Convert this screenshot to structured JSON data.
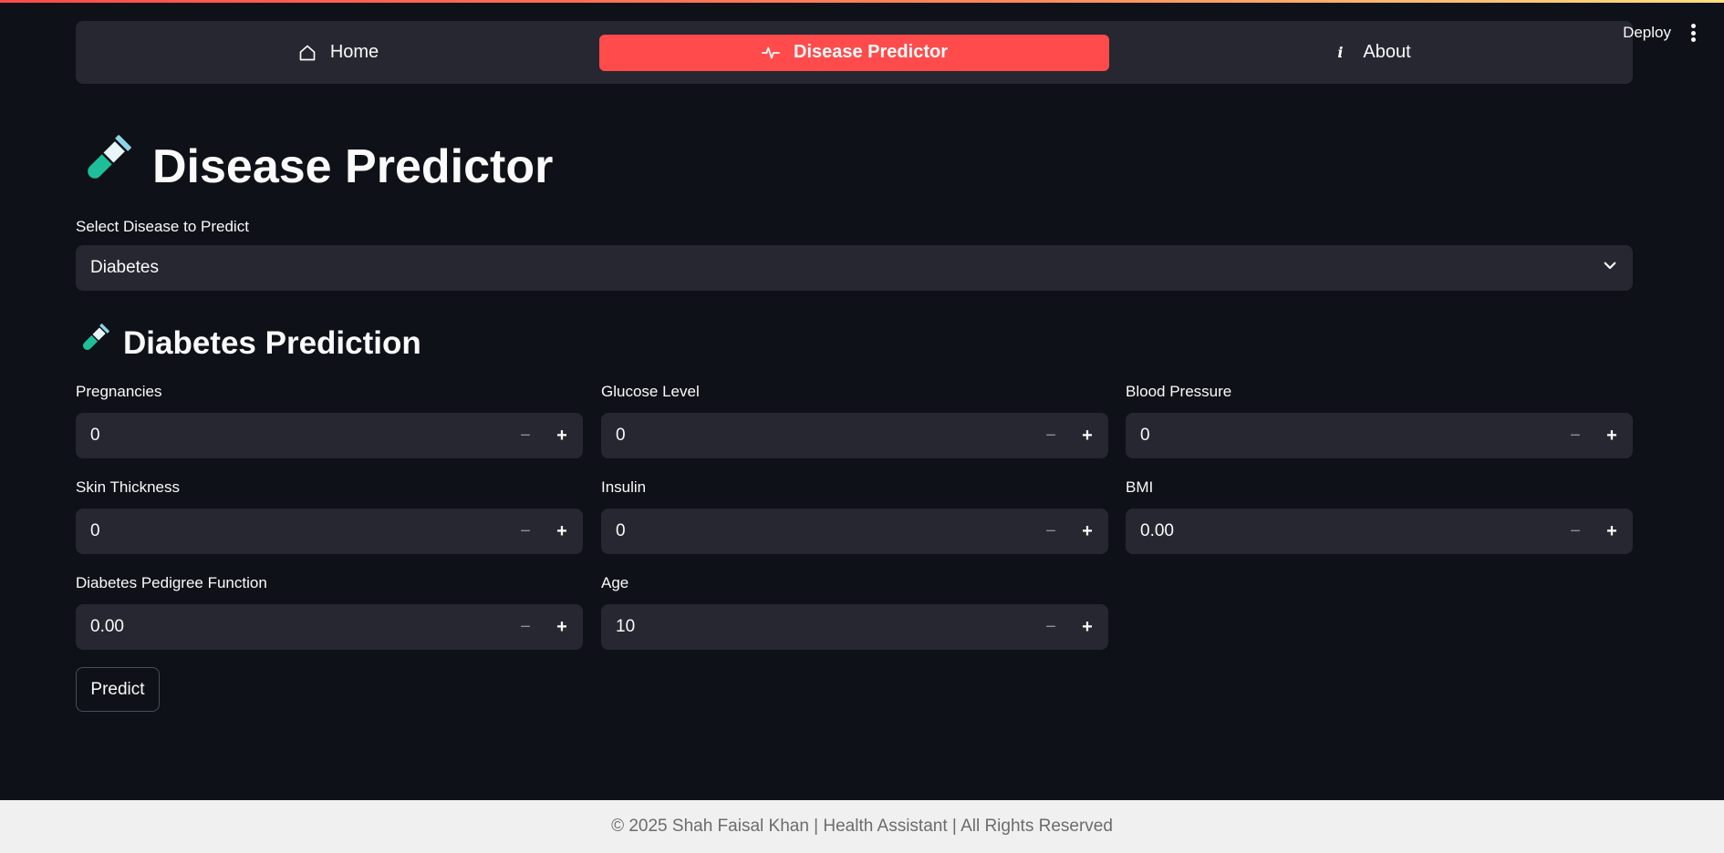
{
  "header": {
    "deploy_label": "Deploy",
    "menu_icon": "more-vertical-icon"
  },
  "nav": {
    "items": [
      {
        "label": "Home",
        "icon": "home-icon",
        "active": false
      },
      {
        "label": "Disease Predictor",
        "icon": "activity-icon",
        "active": true
      },
      {
        "label": "About",
        "icon": "info-icon",
        "active": false
      }
    ],
    "active_color": "#ff4b4b"
  },
  "page": {
    "title": "Disease Predictor",
    "title_icon": "test-tube-icon"
  },
  "disease_select": {
    "label": "Select Disease to Predict",
    "selected": "Diabetes"
  },
  "section": {
    "title": "Diabetes Prediction",
    "icon": "test-tube-icon"
  },
  "fields": [
    {
      "label": "Pregnancies",
      "value": "0"
    },
    {
      "label": "Glucose Level",
      "value": "0"
    },
    {
      "label": "Blood Pressure",
      "value": "0"
    },
    {
      "label": "Skin Thickness",
      "value": "0"
    },
    {
      "label": "Insulin",
      "value": "0"
    },
    {
      "label": "BMI",
      "value": "0.00"
    },
    {
      "label": "Diabetes Pedigree Function",
      "value": "0.00"
    },
    {
      "label": "Age",
      "value": "10"
    }
  ],
  "predict_label": "Predict",
  "footer": {
    "text": "© 2025 Shah Faisal Khan | Health Assistant | All Rights Reserved"
  },
  "colors": {
    "background": "#0e1117",
    "surface": "#262730",
    "accent": "#ff4b4b",
    "footer_bg": "#f0f0f0"
  }
}
